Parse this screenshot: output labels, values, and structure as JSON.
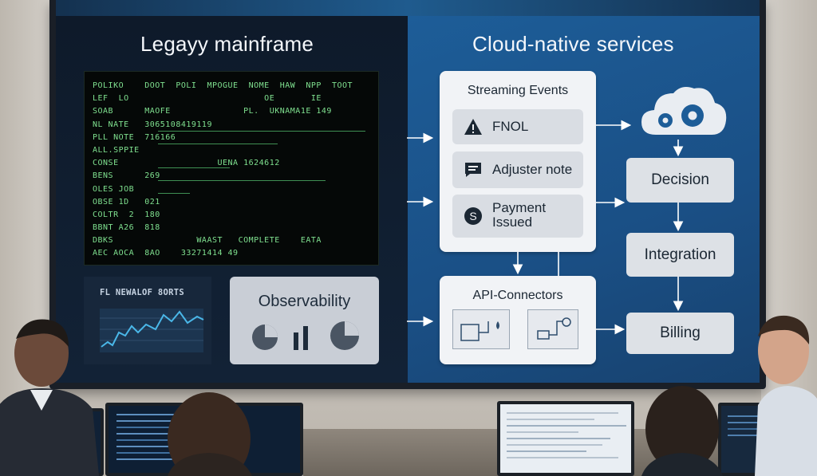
{
  "left_pane": {
    "title": "Legayy mainframe",
    "terminal_lines": [
      "POLIKO    DOOT  POLI  MPOGUE  NOME  HAW  NPP  TOOT",
      "LEF  LO                          OE       IE",
      "SOAB      MAOFE              PL.  UKNAMA1E 149",
      "NL NATE   3065108419119",
      "PLL NOTE  716166",
      "ALL.SPPIE",
      "CONSE                   UENA 1624612",
      "BENS      269",
      "OLES JOB",
      "OBSE 1D   021",
      "COLTR  2  180",
      "BBNT A26  818",
      "DBKS                WAAST   COMPLETE    EATA",
      "AEC AOCA  8AO    33271414 49"
    ],
    "chart_panel_title": "FL NEWALOF 8ORTS",
    "observability_title": "Observability"
  },
  "right_pane": {
    "title": "Cloud-native services",
    "streaming_title": "Streaming Events",
    "events": [
      {
        "label": "FNOL",
        "icon": "warning-icon"
      },
      {
        "label": "Adjuster note",
        "icon": "chat-icon"
      },
      {
        "label": "Payment\nIssued",
        "icon": "dollar-icon"
      }
    ],
    "api_title": "API-Connectors",
    "stages": [
      "Decision",
      "Integration",
      "Billing"
    ],
    "cloud_icon": "cloud-gear-icon"
  },
  "colors": {
    "left_pane_bg": "#0f1b2b",
    "right_pane_bg": "#1d5d98",
    "terminal_text": "#7fe08f",
    "box_bg": "#f1f3f6"
  }
}
